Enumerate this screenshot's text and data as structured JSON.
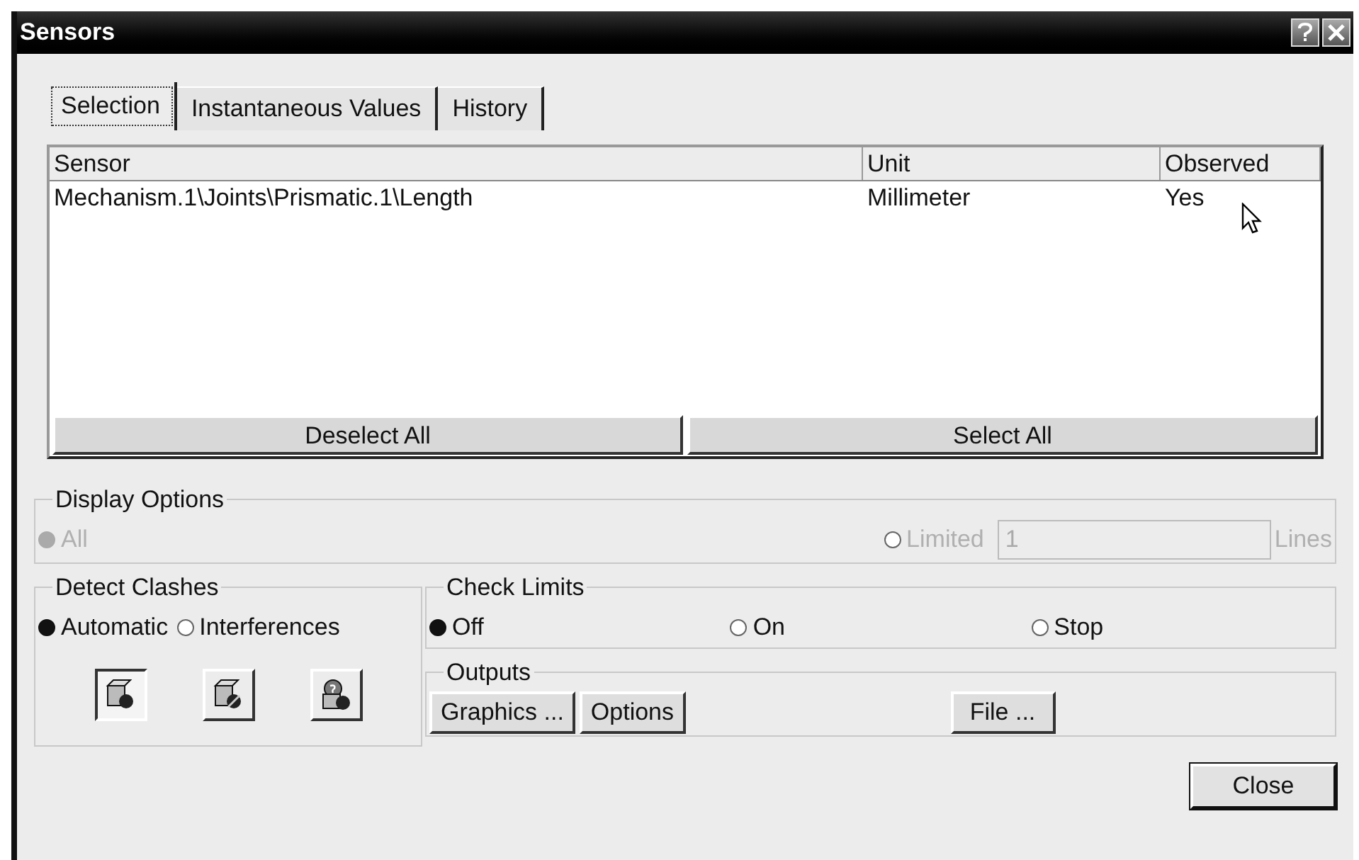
{
  "window": {
    "title": "Sensors"
  },
  "tabs": [
    {
      "label": "Selection",
      "selected": true
    },
    {
      "label": "Instantaneous Values",
      "selected": false
    },
    {
      "label": "History",
      "selected": false
    }
  ],
  "table": {
    "columns": [
      "Sensor",
      "Unit",
      "Observed"
    ],
    "rows": [
      [
        "Mechanism.1\\Joints\\Prismatic.1\\Length",
        "Millimeter",
        "Yes"
      ]
    ]
  },
  "list_buttons": [
    "Deselect All",
    "Select All"
  ],
  "display_options": {
    "title": "Display Options",
    "disabled": true,
    "options": [
      {
        "label": "All",
        "selected": true
      },
      {
        "label": "Limited",
        "selected": false
      }
    ],
    "lines_value": "1",
    "lines_unit": "Lines"
  },
  "detect_clashes": {
    "title": "Detect Clashes",
    "options": [
      {
        "label": "Automatic",
        "selected": true
      },
      {
        "label": "Interferences",
        "selected": false
      }
    ],
    "mode_buttons": [
      {
        "kind": "plain",
        "selected": true
      },
      {
        "kind": "pen",
        "selected": false
      },
      {
        "kind": "stop",
        "selected": false
      }
    ]
  },
  "check_limits": {
    "title": "Check Limits",
    "options": [
      {
        "label": "Off",
        "selected": true
      },
      {
        "label": "On",
        "selected": false
      },
      {
        "label": "Stop",
        "selected": false
      }
    ]
  },
  "outputs": {
    "title": "Outputs",
    "buttons": [
      "Graphics ...",
      "Options",
      "File ..."
    ]
  },
  "close_button": "Close"
}
